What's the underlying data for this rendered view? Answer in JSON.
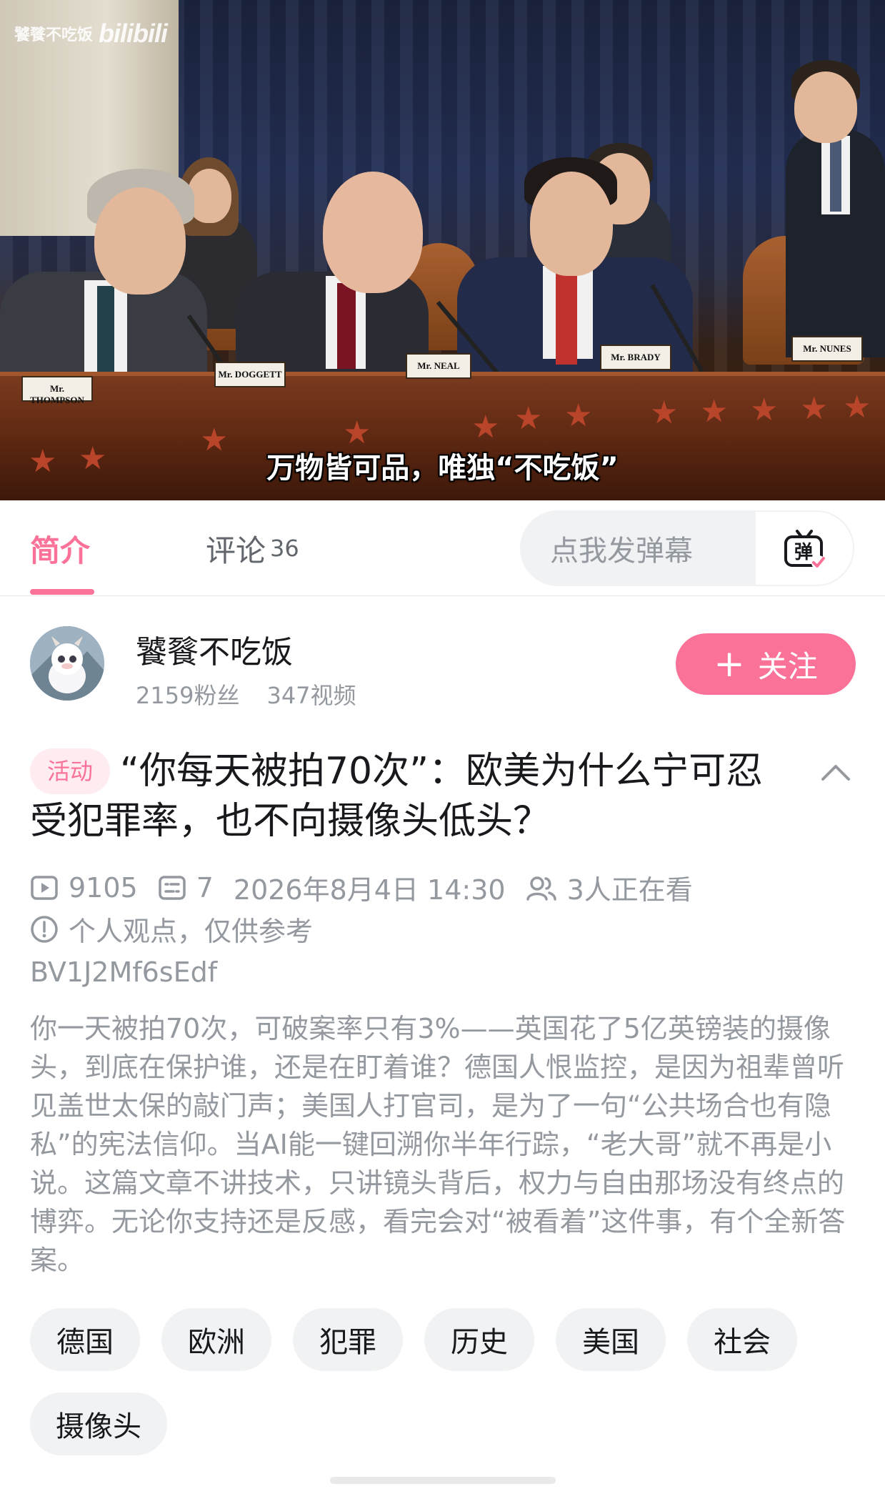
{
  "video": {
    "watermark_name": "饕餮不吃饭",
    "watermark_logo": "bilibili",
    "subtitle": "万物皆可品，唯独“不吃饭”",
    "nameplates": [
      "Mr. THOMPSON",
      "Mr. DOGGETT",
      "Mr. NEAL",
      "Mr. BRADY",
      "Mr. NUNES"
    ]
  },
  "tabs": {
    "intro_label": "简介",
    "comments_label": "评论",
    "comments_count": "36",
    "danmaku_placeholder": "点我发弹幕",
    "danmaku_icon_label": "弹"
  },
  "uploader": {
    "name": "饕餮不吃饭",
    "fans": "2159粉丝",
    "videos": "347视频",
    "follow_label": "关注",
    "follow_plus": "+"
  },
  "video_info": {
    "activity_tag": "活动",
    "title": "“你每天被拍70次”：欧美为什么宁可忍受犯罪率，也不向摄像头低头？",
    "views": "9105",
    "danmaku_count": "7",
    "publish_time": "2026年8月4日 14:30",
    "watching": "3人正在看",
    "notice": "个人观点，仅供参考",
    "bvid": "BV1J2Mf6sEdf",
    "description": "你一天被拍70次，可破案率只有3%——英国花了5亿英镑装的摄像头，到底在保护谁，还是在盯着谁？德国人恨监控，是因为祖辈曾听见盖世太保的敲门声；美国人打官司，是为了一句“公共场合也有隐私”的宪法信仰。当AI能一键回溯你半年行踪，“老大哥”就不再是小说。这篇文章不讲技术，只讲镜头背后，权力与自由那场没有终点的博弈。无论你支持还是反感，看完会对“被看着”这件事，有个全新答案。"
  },
  "tags": [
    "德国",
    "欧洲",
    "犯罪",
    "历史",
    "美国",
    "社会",
    "摄像头"
  ],
  "colors": {
    "accent": "#fb7299",
    "muted": "#9499a0",
    "text": "#18191c"
  }
}
